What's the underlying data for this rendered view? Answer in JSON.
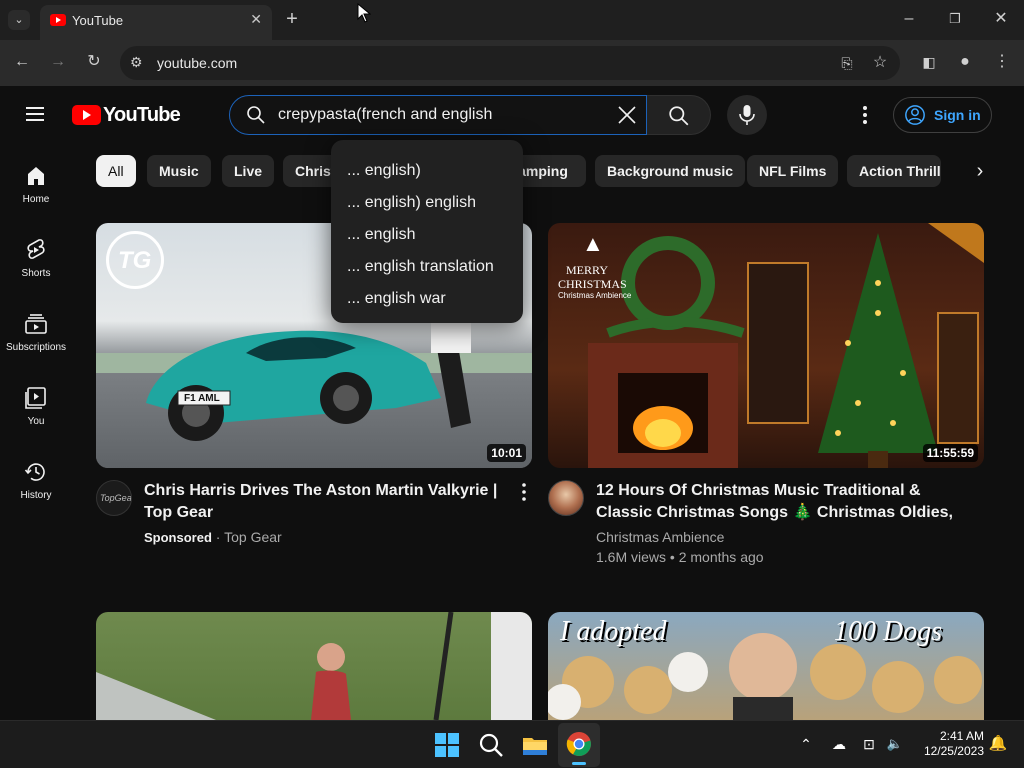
{
  "browser": {
    "tab_title": "YouTube",
    "url": "youtube.com"
  },
  "header": {
    "logo_text": "YouTube",
    "search_query": "crepypasta(french and english",
    "signin_label": "Sign in"
  },
  "sidebar": {
    "items": [
      {
        "label": "Home",
        "icon": "home-icon"
      },
      {
        "label": "Shorts",
        "icon": "shorts-icon"
      },
      {
        "label": "Subscriptions",
        "icon": "subscriptions-icon"
      },
      {
        "label": "You",
        "icon": "you-icon"
      },
      {
        "label": "History",
        "icon": "history-icon"
      }
    ]
  },
  "chips": [
    "All",
    "Music",
    "Live",
    "Christ",
    "Camping",
    "Background music",
    "NFL Films",
    "Action Thrille"
  ],
  "suggestions": [
    "... english)",
    "... english) english",
    "...  english",
    "...  english translation",
    "...  english war"
  ],
  "videos": [
    {
      "title": "Chris Harris Drives The Aston Martin Valkyrie | Top Gear",
      "duration": "10:01",
      "sponsored": "Sponsored",
      "channel": "Top Gear",
      "plate": "F1 AML",
      "logo_badge": "TG"
    },
    {
      "title": "12 Hours Of Christmas Music Traditional & Classic Christmas Songs 🎄 Christmas Oldies, Fireplace…",
      "duration": "11:55:59",
      "channel": "Christmas Ambience",
      "views": "1.6M views",
      "age": "2 months ago",
      "thumb_text_1": "MERRY",
      "thumb_text_2": "CHRISTMAS",
      "thumb_text_3": "Christmas Ambience"
    }
  ],
  "row2": {
    "right_thumb_left": "I adopted",
    "right_thumb_right": "100 Dogs"
  },
  "taskbar": {
    "time": "2:41 AM",
    "date": "12/25/2023"
  },
  "colors": {
    "accent_blue": "#3ea6ff",
    "yt_red": "#ff0000",
    "background": "#0f0f0f"
  }
}
